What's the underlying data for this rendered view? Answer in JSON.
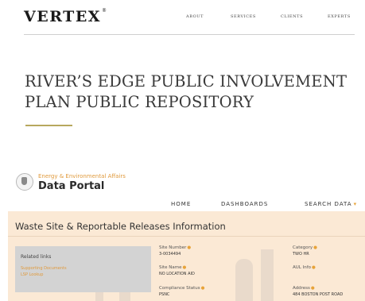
{
  "site": {
    "logo": "VERTEX",
    "logo_mark": "®",
    "nav": [
      "ABOUT",
      "SERVICES",
      "CLIENTS",
      "EXPERTS"
    ]
  },
  "page": {
    "title_line1": "RIVER’S EDGE PUBLIC INVOLVEMENT",
    "title_line2": "PLAN PUBLIC REPOSITORY"
  },
  "portal": {
    "brand_sub": "Energy & Environmental Affairs",
    "brand_main": "Data Portal",
    "nav": {
      "home": "HOME",
      "dashboards": "DASHBOARDS",
      "search": "SEARCH DATA"
    },
    "search_caret": "▾",
    "section_title": "Waste Site & Reportable Releases Information",
    "related": {
      "heading": "Related links",
      "links": [
        "Supporting Documents",
        "LSP Lookup"
      ]
    },
    "fields": {
      "site_number": {
        "label": "Site Number",
        "value": "3-0034494"
      },
      "site_name": {
        "label": "Site Name",
        "value": "NO LOCATION AID"
      },
      "compliance": {
        "label": "Compliance Status",
        "value": "PSNC"
      },
      "category": {
        "label": "Category",
        "value": "TWO HR"
      },
      "aul": {
        "label": "AUL Info",
        "value": ""
      },
      "address": {
        "label": "Address",
        "value": "484 BOSTON POST ROAD"
      }
    },
    "info_icon": "●",
    "colors": {
      "accent": "#e7a339",
      "panel": "#fbe9d5",
      "gold_rule": "#b7a85e"
    }
  }
}
